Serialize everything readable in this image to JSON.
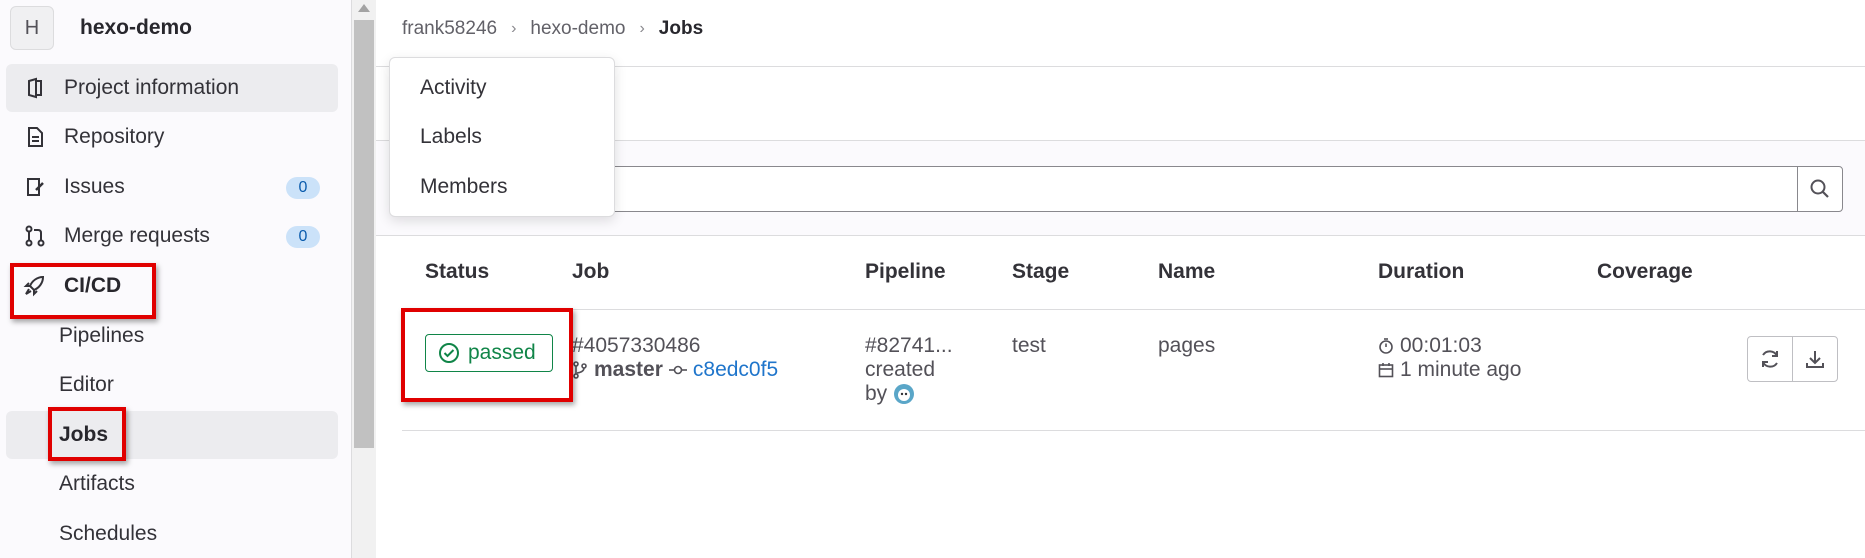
{
  "project": {
    "avatar_letter": "H",
    "name": "hexo-demo"
  },
  "sidebar": {
    "items": [
      {
        "label": "Project information",
        "icon": "project-info-icon"
      },
      {
        "label": "Repository",
        "icon": "document-icon"
      },
      {
        "label": "Issues",
        "icon": "issues-icon",
        "badge": "0"
      },
      {
        "label": "Merge requests",
        "icon": "merge-request-icon",
        "badge": "0"
      },
      {
        "label": "CI/CD",
        "icon": "rocket-icon"
      }
    ],
    "cicd_sub": [
      "Pipelines",
      "Editor",
      "Jobs",
      "Artifacts",
      "Schedules"
    ]
  },
  "breadcrumb": {
    "owner": "frank58246",
    "project": "hexo-demo",
    "current": "Jobs"
  },
  "dropdown": {
    "items": [
      "Activity",
      "Labels",
      "Members"
    ]
  },
  "table": {
    "headers": [
      "Status",
      "Job",
      "Pipeline",
      "Stage",
      "Name",
      "Duration",
      "Coverage"
    ],
    "row": {
      "status": "passed",
      "job_id": "#4057330486",
      "branch": "master",
      "commit": "c8edc0f5",
      "pipeline": "#82741...",
      "pipeline_created": "created",
      "pipeline_by": "by",
      "stage": "test",
      "name": "pages",
      "duration": "00:01:03",
      "finished": "1 minute ago"
    }
  },
  "colors": {
    "success": "#108548",
    "link": "#1f75cb",
    "highlight": "#e00000"
  }
}
